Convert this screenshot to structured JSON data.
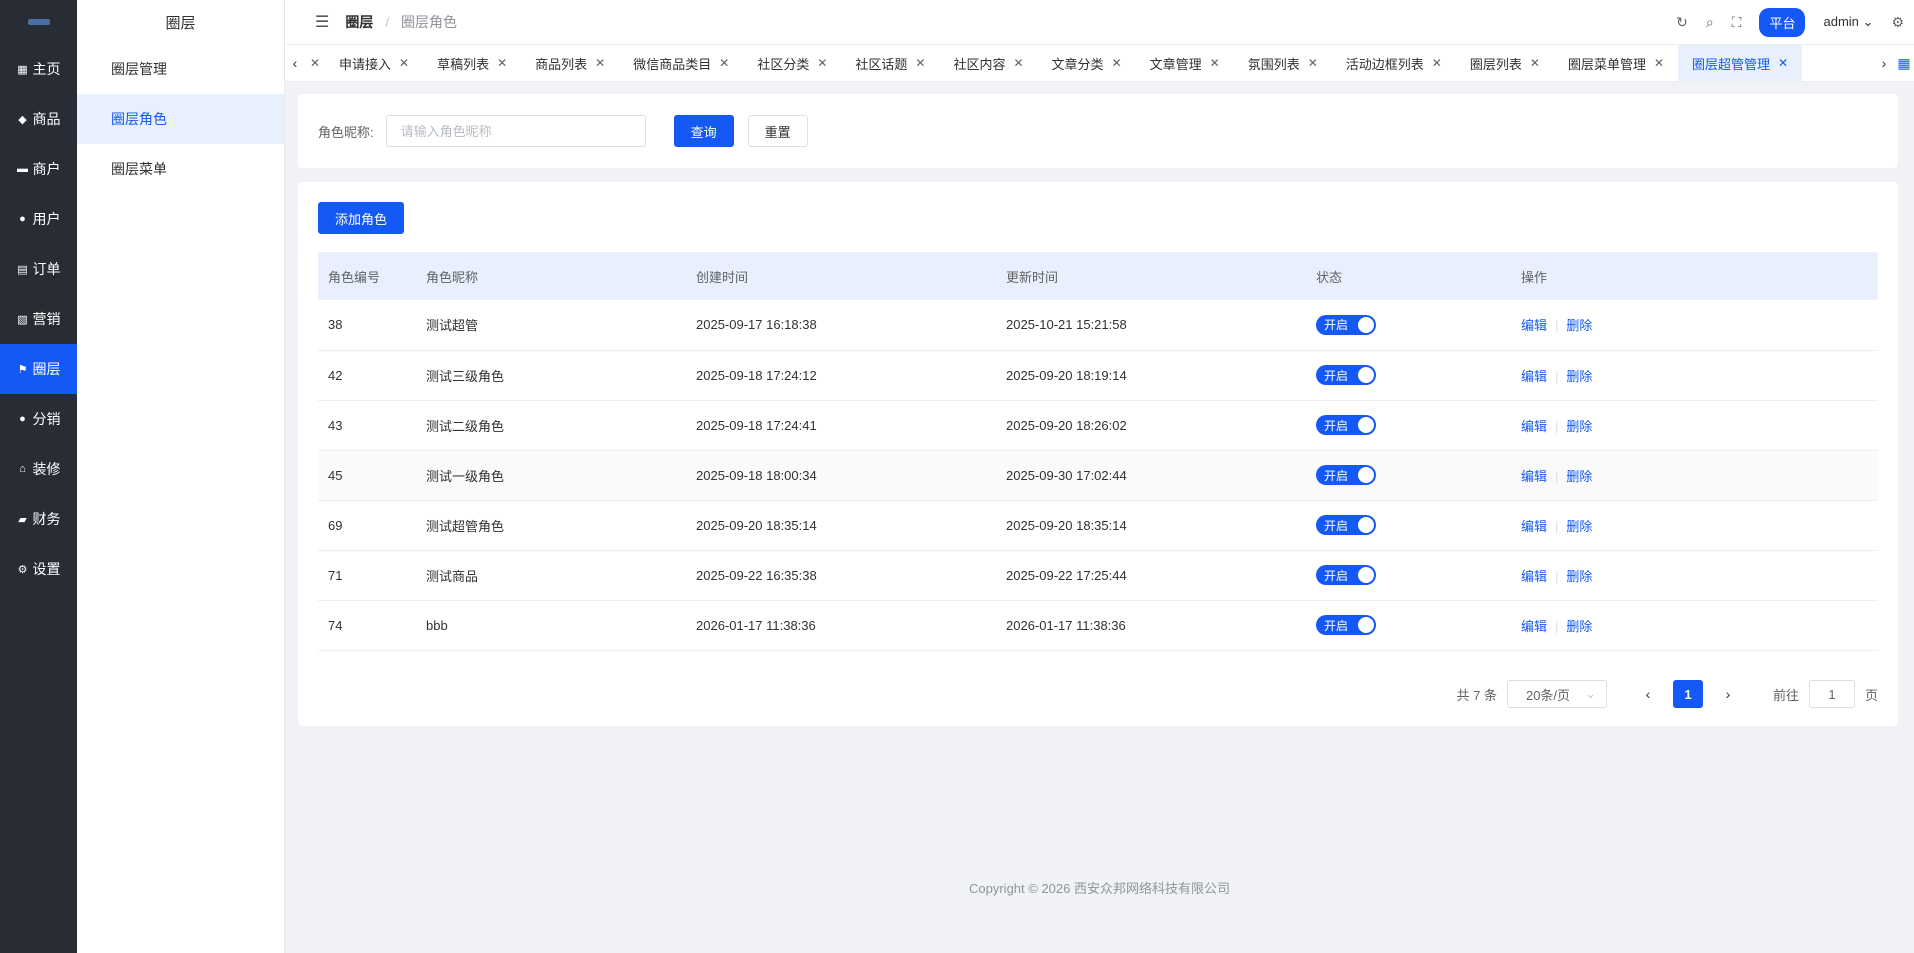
{
  "nav": {
    "items": [
      {
        "label": "主页",
        "icon": "grid-icon"
      },
      {
        "label": "商品",
        "icon": "bag-icon"
      },
      {
        "label": "商户",
        "icon": "store-icon"
      },
      {
        "label": "用户",
        "icon": "user-icon"
      },
      {
        "label": "订单",
        "icon": "clipboard-icon"
      },
      {
        "label": "营销",
        "icon": "chart-icon"
      },
      {
        "label": "圈层",
        "icon": "flag-icon"
      },
      {
        "label": "分销",
        "icon": "person-icon"
      },
      {
        "label": "装修",
        "icon": "home-icon"
      },
      {
        "label": "财务",
        "icon": "wallet-icon"
      },
      {
        "label": "设置",
        "icon": "gear-icon"
      }
    ],
    "active_index": 6
  },
  "sub": {
    "title": "圈层",
    "items": [
      "圈层管理",
      "圈层角色",
      "圈层菜单"
    ],
    "active_index": 1
  },
  "header": {
    "crumb_parent": "圈层",
    "crumb_current": "圈层角色",
    "platform": "平台",
    "user": "admin"
  },
  "tabs": {
    "items": [
      "申请接入",
      "草稿列表",
      "商品列表",
      "微信商品类目",
      "社区分类",
      "社区话题",
      "社区内容",
      "文章分类",
      "文章管理",
      "氛围列表",
      "活动边框列表",
      "圈层列表",
      "圈层菜单管理",
      "圈层超管管理"
    ],
    "active_index": 13
  },
  "search": {
    "label": "角色昵称:",
    "placeholder": "请输入角色昵称",
    "query": "查询",
    "reset": "重置"
  },
  "table": {
    "add_button": "添加角色",
    "columns": [
      "角色编号",
      "角色昵称",
      "创建时间",
      "更新时间",
      "状态",
      "操作"
    ],
    "rows": [
      {
        "id": "38",
        "name": "测试超管",
        "created": "2025-09-17 16:18:38",
        "updated": "2025-10-21 15:21:58"
      },
      {
        "id": "42",
        "name": "测试三级角色",
        "created": "2025-09-18 17:24:12",
        "updated": "2025-09-20 18:19:14"
      },
      {
        "id": "43",
        "name": "测试二级角色",
        "created": "2025-09-18 17:24:41",
        "updated": "2025-09-20 18:26:02"
      },
      {
        "id": "45",
        "name": "测试一级角色",
        "created": "2025-09-18 18:00:34",
        "updated": "2025-09-30 17:02:44"
      },
      {
        "id": "69",
        "name": "测试超管角色",
        "created": "2025-09-20 18:35:14",
        "updated": "2025-09-20 18:35:14"
      },
      {
        "id": "71",
        "name": "测试商品",
        "created": "2025-09-22 16:35:38",
        "updated": "2025-09-22 17:25:44"
      },
      {
        "id": "74",
        "name": "bbb",
        "created": "2026-01-17 11:38:36",
        "updated": "2026-01-17 11:38:36"
      }
    ],
    "status_on": "开启",
    "edit": "编辑",
    "delete": "删除"
  },
  "pager": {
    "total": "共 7 条",
    "size": "20条/页",
    "current": "1",
    "goto": "前往",
    "goto_value": "1",
    "page_unit": "页"
  },
  "footer": "Copyright © 2026 西安众邦网络科技有限公司",
  "colors": {
    "primary": "#1458f5",
    "nav_bg": "#282c34"
  }
}
